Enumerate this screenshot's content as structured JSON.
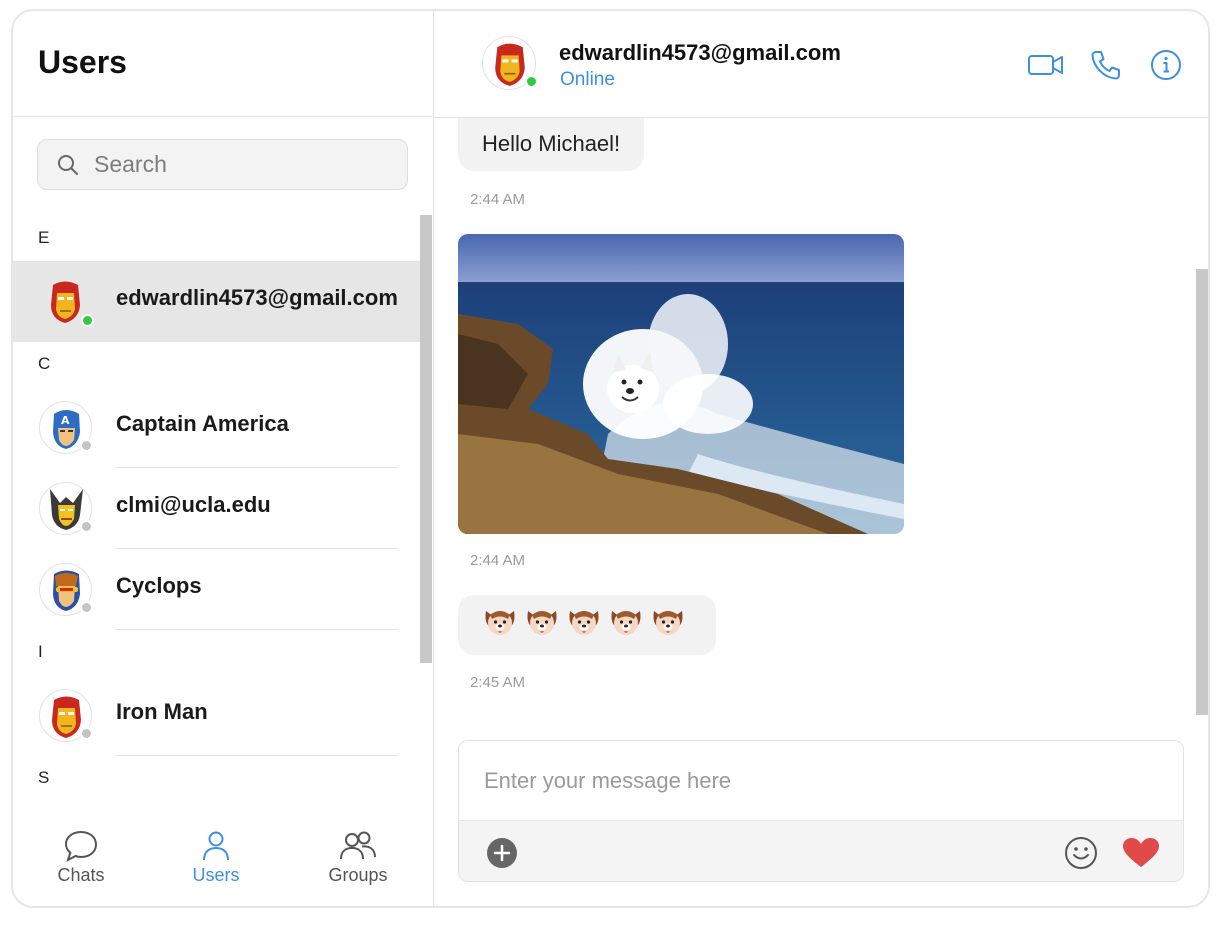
{
  "sidebar": {
    "title": "Users",
    "search_placeholder": "Search",
    "sections": [
      {
        "letter": "E",
        "users": [
          {
            "name": "edwardlin4573@gmail.com",
            "status": "online",
            "active": true,
            "avatar": "iron-man-icon"
          }
        ]
      },
      {
        "letter": "C",
        "users": [
          {
            "name": "Captain America",
            "status": "offline",
            "avatar": "captain-america-icon"
          },
          {
            "name": "clmi@ucla.edu",
            "status": "offline",
            "avatar": "wolverine-icon"
          },
          {
            "name": "Cyclops",
            "status": "offline",
            "avatar": "cyclops-icon"
          }
        ]
      },
      {
        "letter": "I",
        "users": [
          {
            "name": "Iron Man",
            "status": "offline",
            "avatar": "iron-man-icon"
          }
        ]
      },
      {
        "letter": "S",
        "users": []
      }
    ],
    "nav": [
      {
        "label": "Chats",
        "icon": "chat-bubble-icon",
        "active": false
      },
      {
        "label": "Users",
        "icon": "user-icon",
        "active": true
      },
      {
        "label": "Groups",
        "icon": "group-icon",
        "active": false
      }
    ]
  },
  "chat": {
    "contact_name": "edwardlin4573@gmail.com",
    "contact_status": "Online",
    "header_actions": [
      "video-call-icon",
      "phone-icon",
      "info-icon"
    ],
    "messages": [
      {
        "type": "text",
        "text": "Hello Michael!",
        "time": "2:44 AM"
      },
      {
        "type": "image",
        "description": "samoyed-wave-photo",
        "time": "2:44 AM"
      },
      {
        "type": "emoji",
        "text": "🐶🐶🐶🐶🐶",
        "count": 5,
        "time": "2:45 AM"
      }
    ],
    "composer_placeholder": "Enter your message here"
  },
  "colors": {
    "accent": "#3d8fe0",
    "online": "#2ecc40",
    "offline": "#c4c4c4",
    "heart": "#e04a48",
    "active_row": "#e6e6e6"
  }
}
